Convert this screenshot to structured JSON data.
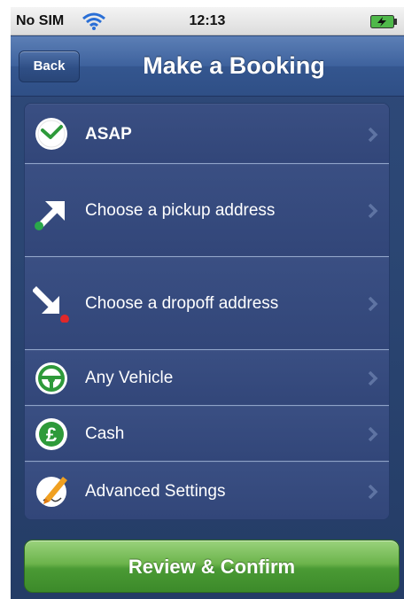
{
  "status_bar": {
    "carrier": "No SIM",
    "time": "12:13"
  },
  "nav_bar": {
    "back_label": "Back",
    "title": "Make a Booking"
  },
  "rows": [
    {
      "label": "ASAP",
      "icon": "clock-icon",
      "bold": true
    },
    {
      "label": "Choose a pickup address",
      "icon": "pickup-arrow-icon",
      "bold": false
    },
    {
      "label": "Choose a dropoff address",
      "icon": "dropoff-arrow-icon",
      "bold": false
    },
    {
      "label": "Any Vehicle",
      "icon": "steering-wheel-icon",
      "bold": false
    },
    {
      "label": "Cash",
      "icon": "pound-coin-icon",
      "bold": false
    },
    {
      "label": "Advanced Settings",
      "icon": "pen-paper-icon",
      "bold": false
    }
  ],
  "confirm_button": {
    "label": "Review & Confirm"
  },
  "colors": {
    "nav_blue": "#3e629d",
    "list_blue": "#33487a",
    "confirm_green": "#4a9a34",
    "clock_green": "#2e9a3a",
    "pickup_dot": "#2aa84a",
    "dropoff_dot": "#e0282a"
  }
}
